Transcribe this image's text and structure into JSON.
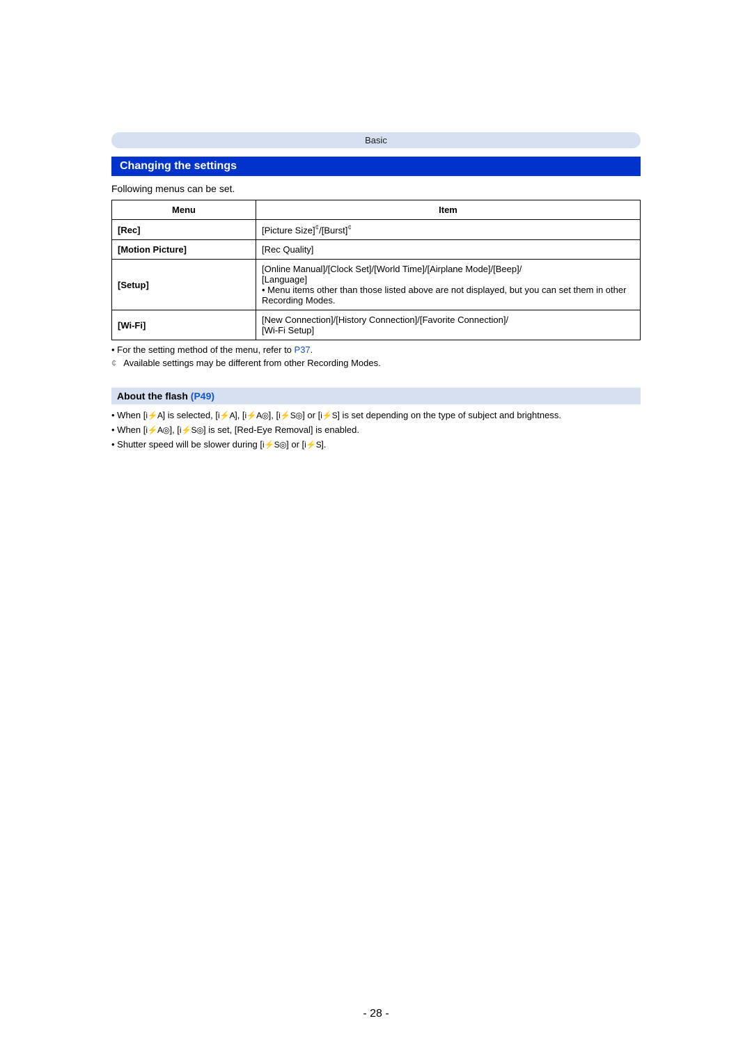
{
  "header": {
    "category": "Basic"
  },
  "section": {
    "title": "Changing the settings",
    "intro": "Following menus can be set."
  },
  "table": {
    "headers": {
      "menu": "Menu",
      "item": "Item"
    },
    "rows": [
      {
        "menu": "[Rec]",
        "item_parts": {
          "a": "[Picture Size]",
          "sup1": "¢",
          "b": "/[Burst]",
          "sup2": "¢"
        }
      },
      {
        "menu": "[Motion Picture]",
        "item_text": "[Rec Quality]"
      },
      {
        "menu": "[Setup]",
        "item_lines": {
          "l1": "[Online Manual]/[Clock Set]/[World Time]/[Airplane Mode]/[Beep]/",
          "l2": "[Language]",
          "note_prefix": "• ",
          "note": "Menu items other than those listed above are not displayed, but you can set them in other Recording Modes."
        }
      },
      {
        "menu": "[Wi-Fi]",
        "item_lines": {
          "l1": "[New Connection]/[History Connection]/[Favorite Connection]/",
          "l2": "[Wi-Fi Setup]"
        }
      }
    ]
  },
  "notes": {
    "method_prefix": "For the setting method of the menu, refer to ",
    "method_link": "P37",
    "method_suffix": ".",
    "star": "¢",
    "star_text": "Available settings may be different from other Recording Modes."
  },
  "flash_section": {
    "title": "About the flash ",
    "link": "(P49)",
    "b1_a": "When [",
    "b1_b": "] is selected, [",
    "b1_c": "], [",
    "b1_d": "], [",
    "b1_e": "] or [",
    "b1_f": "] is set depending on the type of subject and brightness.",
    "b2_a": "When [",
    "b2_b": "], [",
    "b2_c": "] is set, [Red-Eye Removal] is enabled.",
    "b3_a": "Shutter speed will be slower during [",
    "b3_b": "] or [",
    "b3_c": "].",
    "icons": {
      "iA_bolt": "i⚡A",
      "iA_redeye": "i⚡A◎",
      "iS_redeye": "i⚡S◎",
      "iS_bolt": "i⚡S"
    }
  },
  "page_number": "- 28 -"
}
